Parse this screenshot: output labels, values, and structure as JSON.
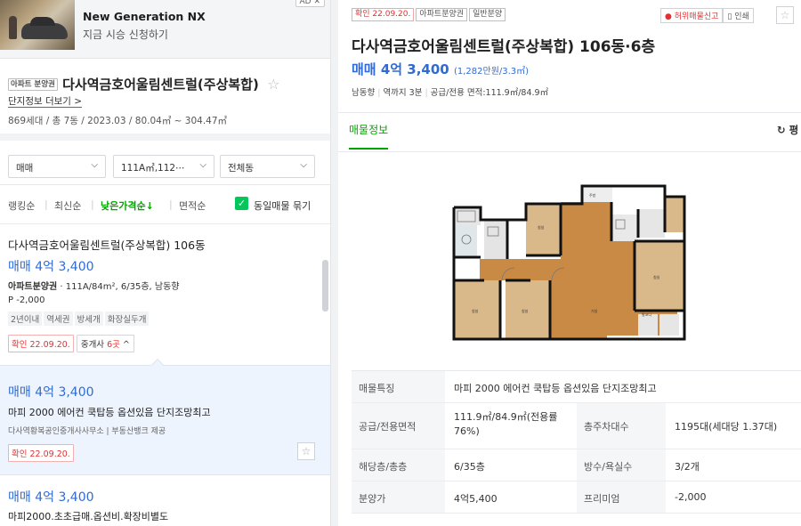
{
  "ad": {
    "title": "New Generation NX",
    "subtitle": "지금 시승 신청하기",
    "badge": "AD ✕"
  },
  "complex": {
    "tag": "아파트 분양권",
    "name": "다사역금호어울림센트럴(주상복합)",
    "more": "단지정보 더보기 >",
    "info": "869세대 / 총 7동 / 2023.03 / 80.04㎡ ~ 304.47㎡"
  },
  "filters": {
    "trade": "매매",
    "area": "111A㎡,112⋯",
    "dong": "전체동"
  },
  "sort": {
    "items": [
      "랭킹순",
      "최신순",
      "낮은가격순↓",
      "면적순"
    ],
    "group_label": "동일매물 묶기"
  },
  "listing": {
    "title": "다사역금호어울림센트럴(주상복합) 106동",
    "price": "매매 4억 3,400",
    "type": "아파트분양권",
    "info": "111A/84m², 6/35층, 남동향",
    "premium": "P -2,000",
    "tags": [
      "2년이내",
      "역세권",
      "방세개",
      "화장실두개"
    ],
    "confirmed": "확인 22.09.20.",
    "agents_prefix": "중개사 ",
    "agents_count": "6곳",
    "agents_suffix": " ^"
  },
  "sub_listings": [
    {
      "price": "매매 4억 3,400",
      "desc": "마피 2000 에어컨 쿡탑등 옵션있음 단지조망최고",
      "agent": "다사역황복공인중개사사무소 | 부동산뱅크 제공",
      "confirmed": "확인 22.09.20."
    },
    {
      "price": "매매 4억 3,400",
      "desc": "마피2000.초초급매.옵션비.확장비별도"
    }
  ],
  "detail": {
    "badges": [
      "확인 22.09.20.",
      "아파트분양권",
      "일반분양"
    ],
    "report": "허위매물신고",
    "print": "인쇄",
    "title": "다사역금호어울림센트럴(주상복합) 106동·6층",
    "price": "매매 4억 3,400",
    "price_per": "(1,282만원/3.3㎡)",
    "info": [
      "남동향",
      "역까지 3분",
      "공급/전용 면적:111.9㎡/84.9㎡"
    ],
    "tab": "매물정보",
    "tab_right": "↻ 평",
    "table": {
      "feature_label": "매물특징",
      "feature_value": "마피 2000 에어컨 쿡탑등 옵션있음 단지조망최고",
      "area_label": "공급/전용면적",
      "area_value": "111.9㎡/84.9㎡(전용률 76%)",
      "parking_label": "총주차대수",
      "parking_value": "1195대(세대당 1.37대)",
      "floor_label": "해당층/총층",
      "floor_value": "6/35층",
      "rooms_label": "방수/욕실수",
      "rooms_value": "3/2개",
      "sale_label": "분양가",
      "sale_value": "4억5,400",
      "premium_label": "프리미엄",
      "premium_value": "-2,000"
    }
  },
  "colors": {
    "accent_green": "#03a600",
    "price_blue": "#2f6bd6",
    "confirm_red": "#e03232"
  }
}
